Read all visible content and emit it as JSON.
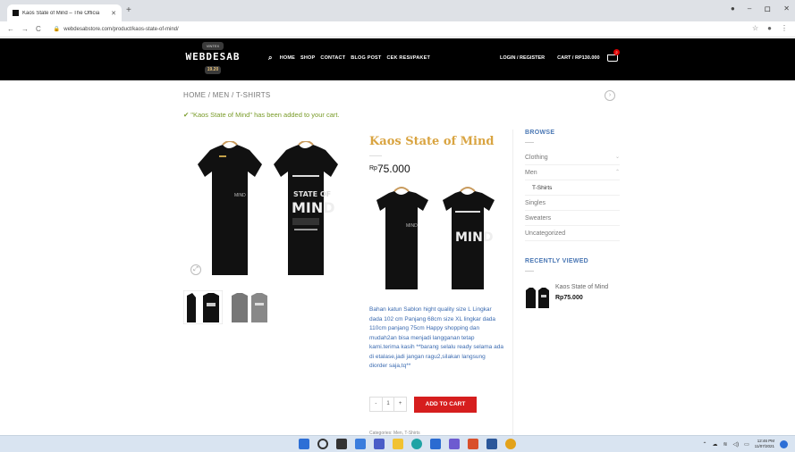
{
  "browser": {
    "tab_title": "Kaos State of Mind – The Officia",
    "tab_close": "✕",
    "new_tab": "+",
    "back": "←",
    "forward": "→",
    "reload": "C",
    "url": "webdesabstore.com/product/kaos-state-of-mind/",
    "win_min": "–",
    "win_max": "ロ",
    "win_close": "✕"
  },
  "header": {
    "logo_top": "VINTEX",
    "logo_main": "WEBDESAB",
    "logo_year": "19.20",
    "nav": [
      "HOME",
      "SHOP",
      "CONTACT",
      "BLOG POST",
      "CEK RESI/PAKET"
    ],
    "login": "LOGIN / REGISTER",
    "cart": "CART / RP130.000",
    "cart_count": "2"
  },
  "breadcrumb": "HOME / MEN / T-SHIRTS",
  "notice": "\"Kaos State of Mind\" has been added to your cart.",
  "product": {
    "title": "Kaos State of Mind",
    "currency": "Rp",
    "price": "75.000",
    "description": "Bahan katun Sablon hight quality size L Lingkar dada 102 cm Panjang 68cm size XL lingkar dada 110cm panjang 75cm Happy shopping dan mudah2an bisa menjadi langganan tetap kami.terima kasih **barang selalu ready selama ada di etalase,jadi jangan ragu2,silakan langsung diorder saja,tq**",
    "qty_minus": "-",
    "qty_value": "1",
    "qty_plus": "+",
    "add_to_cart": "ADD TO CART",
    "categories": "Categories: Men, T-Shirts",
    "print_front": "MIND",
    "print_back": "MIND",
    "print_state": "STATE OF"
  },
  "sidebar": {
    "browse_heading": "BROWSE",
    "items": [
      {
        "label": "Clothing",
        "chev": "⌄"
      },
      {
        "label": "Men",
        "chev": "⌃"
      }
    ],
    "sub_item": "T-Shirts",
    "items_after": [
      "Singles",
      "Sweaters",
      "Uncategorized"
    ],
    "recent_heading": "RECENTLY VIEWED",
    "recent_name": "Kaos State of Mind",
    "recent_price": "Rp75.000"
  },
  "taskbar": {
    "time": "12:46 PM",
    "date": "11/07/2021"
  },
  "colors": {
    "accent": "#d9a441",
    "link": "#4a77b4",
    "button": "#d61e1e",
    "success": "#7a9c2a"
  }
}
